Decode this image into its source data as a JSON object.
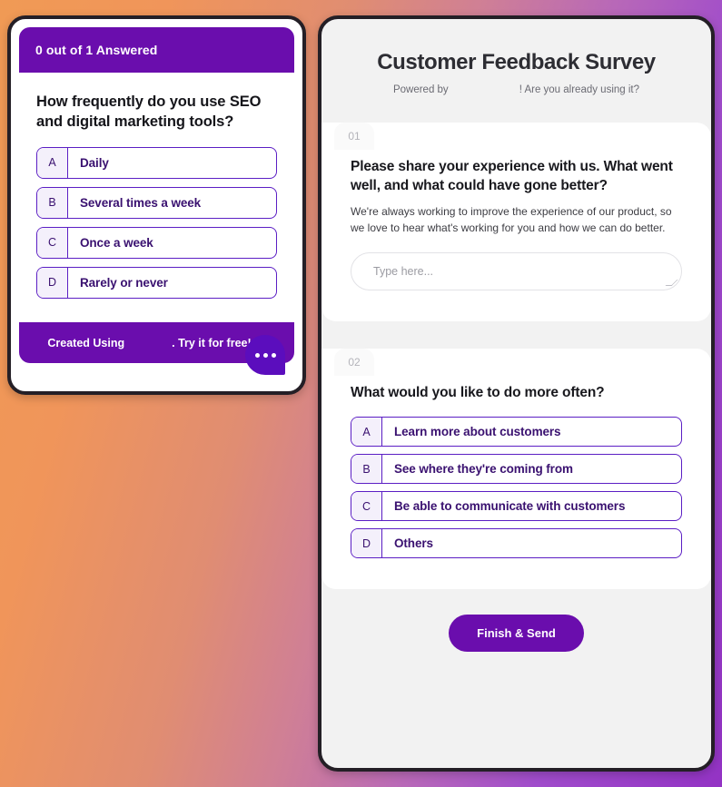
{
  "background": {
    "gradient_from": "#f09a55",
    "gradient_to": "#9333c4"
  },
  "theme": {
    "purple": "#6a0dad",
    "option_border": "#5b1ec4",
    "option_text": "#3a1170",
    "option_letter_bg": "#f4f0fb",
    "panel_bg": "#f2f2f2",
    "card_bg": "#ffffff",
    "frame_border": "#241f26"
  },
  "widget_preview": {
    "progress_label": "0 out of 1 Answered",
    "question": "How frequently do you use SEO and digital marketing tools?",
    "options": [
      {
        "letter": "A",
        "text": "Daily"
      },
      {
        "letter": "B",
        "text": "Several times a week"
      },
      {
        "letter": "C",
        "text": "Once a week"
      },
      {
        "letter": "D",
        "text": "Rarely or never"
      }
    ],
    "footer": {
      "created_using": "Created Using",
      "cta": ". Try it for free! →"
    },
    "chat_button_icon": "ellipsis-icon"
  },
  "survey": {
    "title": "Customer Feedback Survey",
    "subtitle_left": "Powered by",
    "subtitle_right": "! Are you already using it?",
    "questions": [
      {
        "number": "01",
        "title": "Please share your experience with us. What went well, and what could have gone better?",
        "description": "We're always working to improve the experience of our product, so we love to hear what's working for you and how we can do better.",
        "input_placeholder": "Type here...",
        "input_value": ""
      },
      {
        "number": "02",
        "title": "What would you like to do more often?",
        "options": [
          {
            "letter": "A",
            "text": "Learn more about customers"
          },
          {
            "letter": "B",
            "text": "See where they're coming from"
          },
          {
            "letter": "C",
            "text": "Be able to communicate with customers"
          },
          {
            "letter": "D",
            "text": "Others"
          }
        ]
      }
    ],
    "submit_label": "Finish & Send"
  }
}
